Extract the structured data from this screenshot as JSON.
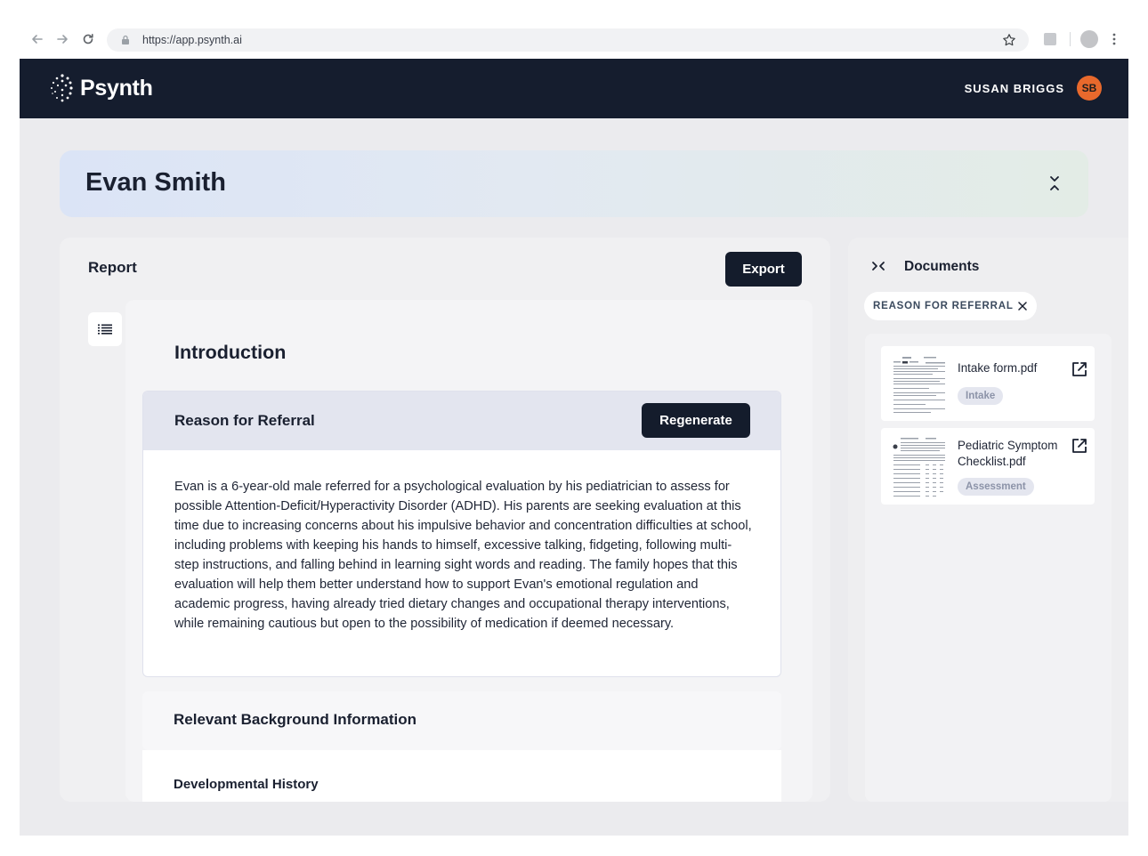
{
  "browser": {
    "url": "https://app.psynth.ai",
    "icons": [
      "back-arrow-icon",
      "forward-arrow-icon",
      "reload-icon",
      "lock-icon",
      "star-icon",
      "extension-icon",
      "profile-icon",
      "kebab-menu-icon"
    ]
  },
  "header": {
    "app_name": "Psynth",
    "user_name": "SUSAN BRIGGS",
    "user_initials": "SB",
    "avatar_color": "#e8692c",
    "background_color": "#151d2e"
  },
  "patient": {
    "name": "Evan Smith"
  },
  "report": {
    "title": "Report",
    "export_label": "Export",
    "section_heading": "Introduction",
    "referral": {
      "title": "Reason for Referral",
      "regenerate_label": "Regenerate",
      "body": "Evan is a 6-year-old male referred for a psychological evaluation by his pediatrician to assess for possible Attention-Deficit/Hyperactivity Disorder (ADHD). His parents are seeking evaluation at this time due to increasing concerns about his impulsive behavior and concentration difficulties at school, including problems with keeping his hands to himself, excessive talking, fidgeting, following multi-step instructions, and falling behind in learning sight words and reading. The family hopes that this evaluation will help them better understand how to support Evan's emotional regulation and academic progress, having already tried dietary changes and occupational therapy interventions, while remaining cautious but open to the possibility of medication if deemed necessary."
    },
    "background": {
      "title": "Relevant Background Information",
      "subsection": "Developmental History"
    }
  },
  "documents": {
    "title": "Documents",
    "filter_chip": "REASON FOR REFERRAL",
    "items": [
      {
        "name": "Intake form.pdf",
        "tag": "Intake"
      },
      {
        "name": "Pediatric Symptom Checklist.pdf",
        "tag": "Assessment"
      }
    ]
  },
  "colors": {
    "primary_button": "#141c2c",
    "page_background": "#ebebee"
  }
}
